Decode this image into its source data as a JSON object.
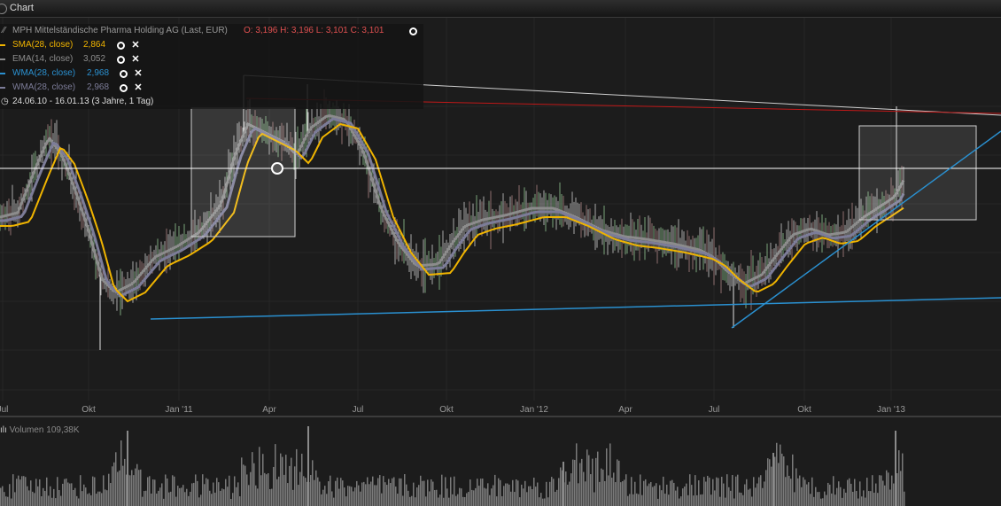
{
  "window": {
    "title": "Chart"
  },
  "legend": {
    "instrument": "MPH Mittelständische Pharma Holding AG (Last, EUR)",
    "ohlc": "O: 3,196  H: 3,196  L: 3,101  C: 3,101",
    "indicators": [
      {
        "label": "SMA(28, close)",
        "value": "2,864",
        "color": "#f0b400"
      },
      {
        "label": "EMA(14, close)",
        "value": "3,052",
        "color": "#8c8c8c"
      },
      {
        "label": "WMA(28, close)",
        "value": "2,968",
        "color": "#2a90d0"
      },
      {
        "label": "WMA(28, close)",
        "value": "2,968",
        "color": "#7c7c98"
      }
    ],
    "period": "24.06.10 - 16.01.13 (3 Jahre, 1 Tag)"
  },
  "volume": {
    "label": "Volumen",
    "value": "109,38K"
  },
  "chart_data": {
    "type": "line",
    "title": "MPH Mittelständische Pharma Holding AG (Last, EUR)",
    "x_tick_labels": [
      "Jul",
      "Okt",
      "Jan '11",
      "Apr",
      "Jul",
      "Okt",
      "Jan '12",
      "Apr",
      "Jul",
      "Okt",
      "Jan '13"
    ],
    "x_range": [
      "2010-06-24",
      "2013-01-16"
    ],
    "y_axis_labels": "none",
    "series": [
      {
        "name": "SMA(28, close)",
        "color": "#f0b400",
        "last_value": 2.864
      },
      {
        "name": "EMA(14, close)",
        "color": "#8c8c8c",
        "last_value": 3.052
      },
      {
        "name": "WMA(28, close)",
        "color": "#2a90d0",
        "last_value": 2.968
      },
      {
        "name": "WMA(28, close)",
        "color": "#7c7c98",
        "last_value": 2.968
      }
    ],
    "last_bar": {
      "open": 3.196,
      "high": 3.196,
      "low": 3.101,
      "close": 3.101
    },
    "volume_last": "109,38K",
    "grid": true
  }
}
